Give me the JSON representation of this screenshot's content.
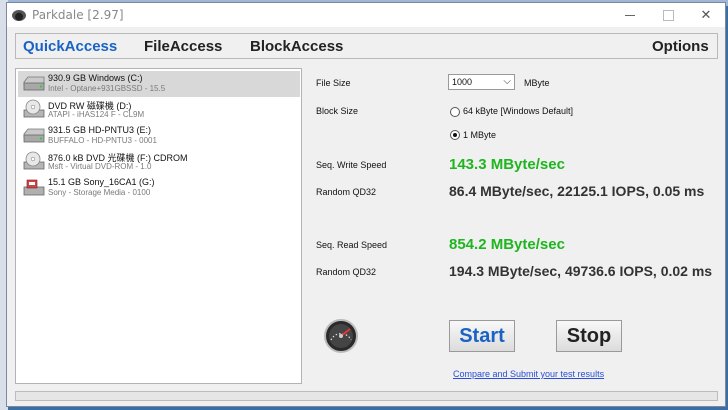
{
  "window": {
    "title": "Parkdale [2.97]"
  },
  "menu": {
    "quick": "QuickAccess",
    "file": "FileAccess",
    "block": "BlockAccess",
    "options": "Options"
  },
  "drives": [
    {
      "name": "930.9 GB Windows (C:)",
      "detail": "Intel - Optane+931GBSSD - 15.5",
      "icon": "hard-drive-icon",
      "selected": true
    },
    {
      "name": "DVD RW 磁碟機 (D:)",
      "detail": "ATAPI - iHAS124   F - CL9M",
      "icon": "dvd-drive-icon"
    },
    {
      "name": "931.5 GB HD-PNTU3 (E:)",
      "detail": "BUFFALO - HD-PNTU3 - 0001",
      "icon": "hard-drive-icon"
    },
    {
      "name": "876.0 kB DVD 光碟機 (F:) CDROM",
      "detail": "Msft - Virtual DVD-ROM - 1.0",
      "icon": "dvd-drive-icon"
    },
    {
      "name": "15.1 GB Sony_16CA1 (G:)",
      "detail": "Sony - Storage Media - 0100",
      "icon": "usb-drive-icon"
    }
  ],
  "settings": {
    "file_size_label": "File Size",
    "file_size_value": "1000",
    "file_size_unit": "MByte",
    "block_size_label": "Block Size",
    "block_opt_1": "64 kByte [Windows Default]",
    "block_opt_2": "1 MByte",
    "selected_block": "1 MByte"
  },
  "results": {
    "write_label": "Seq. Write Speed",
    "write_value": "143.3 MByte/sec",
    "random_write_label": "Random QD32",
    "random_write_value": "86.4 MByte/sec, 22125.1 IOPS, 0.05 ms",
    "read_label": "Seq. Read Speed",
    "read_value": "854.2 MByte/sec",
    "random_read_label": "Random QD32",
    "random_read_value": "194.3 MByte/sec, 49736.6 IOPS, 0.02 ms"
  },
  "actions": {
    "start": "Start",
    "stop": "Stop",
    "compare_link": "Compare and Submit your test results"
  },
  "colors": {
    "accent_blue": "#1a63c4",
    "speed_green": "#1fb51f"
  }
}
